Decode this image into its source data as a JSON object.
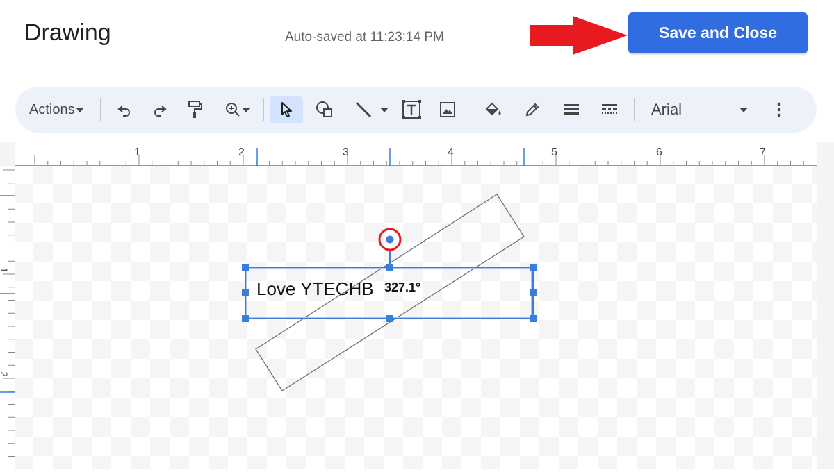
{
  "header": {
    "title": "Drawing",
    "autosave": "Auto-saved at 11:23:14 PM",
    "save_label": "Save and Close"
  },
  "toolbar": {
    "actions_label": "Actions",
    "font": "Arial",
    "tools": [
      "undo-icon",
      "redo-icon",
      "paint-format-icon",
      "zoom-icon",
      "select-icon",
      "shape-icon",
      "line-icon",
      "textbox-icon",
      "image-icon",
      "fill-color-icon",
      "border-color-icon",
      "border-weight-icon",
      "border-dash-icon",
      "more-icon"
    ]
  },
  "ruler": {
    "top_numbers": [
      "1",
      "2",
      "3",
      "4",
      "5",
      "6",
      "7"
    ],
    "left_numbers": [
      "1",
      "2"
    ]
  },
  "canvas": {
    "text": "Love YTECHB",
    "rotation_label": "327.1°"
  },
  "colors": {
    "accent": "#2f6de0",
    "highlight": "#e8191f",
    "selection": "#3b7ddd"
  }
}
